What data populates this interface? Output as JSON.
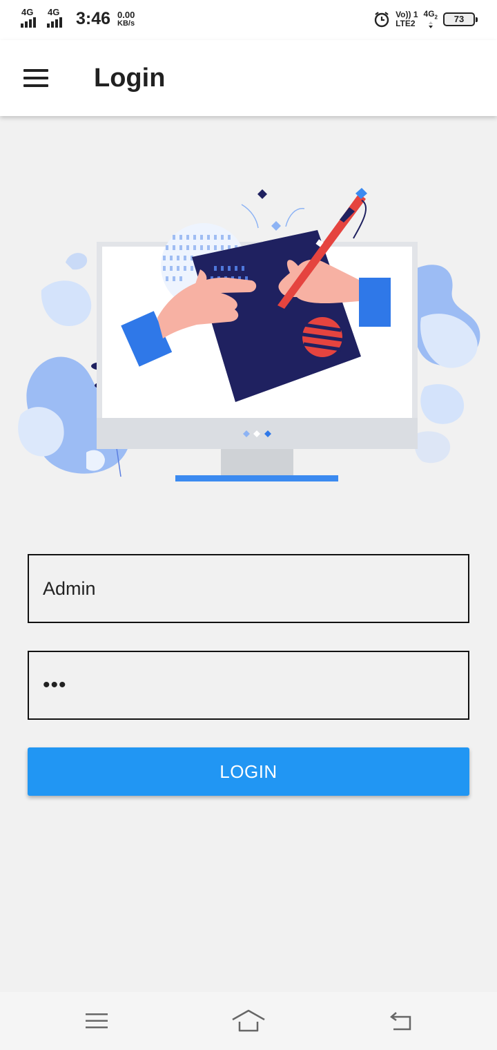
{
  "status_bar": {
    "sim1_network": "4G",
    "sim2_network": "4G",
    "time": "3:46",
    "speed_value": "0.00",
    "speed_unit": "KB/s",
    "volte_label": "Vo))",
    "sim_slot": "1",
    "lte_label": "LTE2",
    "data_network": "4G",
    "data_network_sub": "2",
    "battery_level": "73",
    "icons": [
      "signal-icon",
      "signal-icon",
      "alarm-icon",
      "battery-icon"
    ]
  },
  "app_bar": {
    "title": "Login",
    "menu_icon": "hamburger-menu-icon"
  },
  "form": {
    "username_value": "Admin",
    "password_value": "•••",
    "login_label": "LOGIN"
  },
  "nav_bar": {
    "icons": [
      "recent-apps-icon",
      "home-icon",
      "back-icon"
    ]
  },
  "colors": {
    "accent": "#2196f3",
    "background": "#f1f1f1",
    "app_bar": "#ffffff",
    "illustration_navy": "#1f2160",
    "illustration_red": "#e5443f",
    "illustration_skin": "#f7b1a3"
  }
}
